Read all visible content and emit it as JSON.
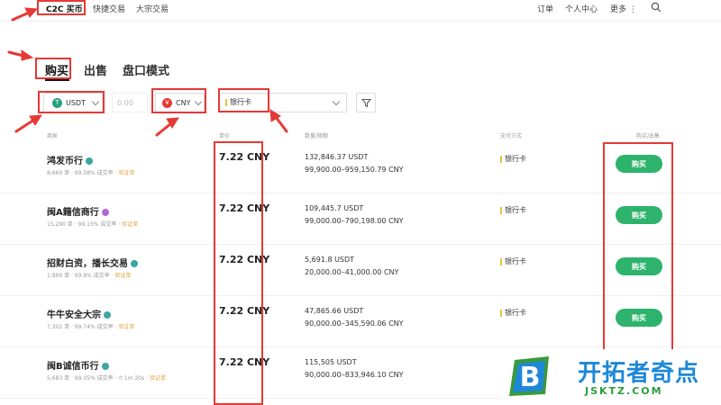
{
  "topnav": {
    "tabs": [
      "C2C 买币",
      "快捷交易",
      "大宗交易"
    ],
    "right": [
      "订单",
      "个人中心",
      "更多"
    ]
  },
  "subtabs": [
    "购买",
    "出售",
    "盘口模式"
  ],
  "filters": {
    "coin": "USDT",
    "amount_placeholder": "0.00",
    "fiat": "CNY",
    "payment": "银行卡"
  },
  "columns": [
    "商家",
    "单价",
    "数量/限额",
    "支付方式",
    "购买/出售"
  ],
  "rows": [
    {
      "merchant": "鸿发币行",
      "meta": "8,669 单 · 99.58% 成交率 · ",
      "meta_tag": "验证单",
      "price": "7.22 CNY",
      "qty": "132,846.37 USDT",
      "limit": "99,900.00–959,150.79 CNY",
      "pay": "银行卡",
      "btn": "购买",
      "badge_color": "#3aa8a0"
    },
    {
      "merchant": "闽A籍信商行",
      "meta": "15,290 单 · 99.15% 成交率 · ",
      "meta_tag": "验证单",
      "price": "7.22 CNY",
      "qty": "109,445.7 USDT",
      "limit": "99,000.00–790,198.00 CNY",
      "pay": "银行卡",
      "btn": "购买",
      "badge_color": "#b06ad8"
    },
    {
      "merchant": "招财白资，播长交易",
      "meta": "1,999 单 · 99.8% 成交率 · ",
      "meta_tag": "验证单",
      "price": "7.22 CNY",
      "qty": "5,691.8 USDT",
      "limit": "20,000.00–41,000.00 CNY",
      "pay": "银行卡",
      "btn": "购买",
      "badge_color": "#3aa8a0"
    },
    {
      "merchant": "牛牛安全大宗",
      "meta": "7,302 单 · 99.74% 成交率 · ",
      "meta_tag": "验证单",
      "price": "7.22 CNY",
      "qty": "47,865.66 USDT",
      "limit": "90,000.00–345,590.06 CNY",
      "pay": "银行卡",
      "btn": "购买",
      "badge_color": "#3aa8a0"
    },
    {
      "merchant": "闽B诚信币行",
      "meta": "5,683 单 · 99.05% 成交率 · ⏱ 1m 20s · ",
      "meta_tag": "验证单",
      "price": "7.22 CNY",
      "qty": "115,505 USDT",
      "limit": "90,000.00–833,946.10 CNY",
      "pay": "",
      "btn": "",
      "badge_color": "#3aa8a0"
    }
  ],
  "logo": {
    "title": "开拓者奇点",
    "url": "JSKTZ.COM"
  },
  "colors": {
    "accent": "#2db36c",
    "annotation": "#e53935"
  }
}
